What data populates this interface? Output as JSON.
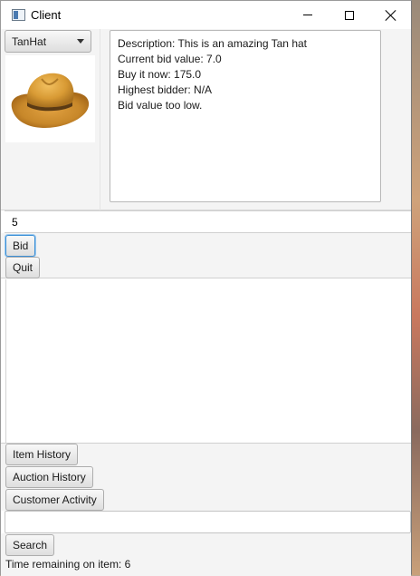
{
  "window": {
    "title": "Client",
    "icon": "application-window-icon",
    "controls": [
      "minimize-icon",
      "maximize-icon",
      "close-icon"
    ]
  },
  "item_select": {
    "selected": "TanHat"
  },
  "item_image": {
    "alt": "Tan hat"
  },
  "description": {
    "lines": [
      "Description: This is an amazing Tan hat",
      "Current bid value: 7.0",
      "Buy it now: 175.0",
      "Highest bidder: N/A",
      "Bid value too low."
    ]
  },
  "bid_field": {
    "value": "5"
  },
  "actions": {
    "bid_label": "Bid",
    "quit_label": "Quit"
  },
  "history": {
    "item_history_label": "Item History",
    "auction_history_label": "Auction History",
    "customer_activity_label": "Customer Activity"
  },
  "search": {
    "value": "",
    "button_label": "Search"
  },
  "status": {
    "time_remaining": "Time remaining on item: 6"
  }
}
